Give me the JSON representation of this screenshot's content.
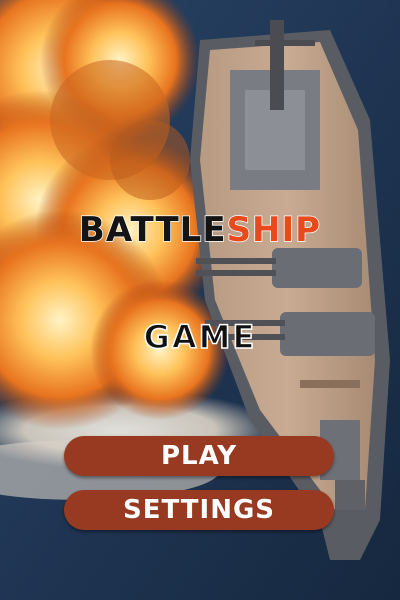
{
  "game": {
    "title_part1": "BATTLE",
    "title_part2": "SHIP",
    "subtitle": "GAME"
  },
  "menu": {
    "play_label": "PLAY",
    "settings_label": "SETTINGS"
  },
  "colors": {
    "title_dark": "#141414",
    "title_accent": "#e8491d",
    "button_bg": "#983a22",
    "button_text": "#ffffff",
    "ocean": "#1d3452"
  }
}
